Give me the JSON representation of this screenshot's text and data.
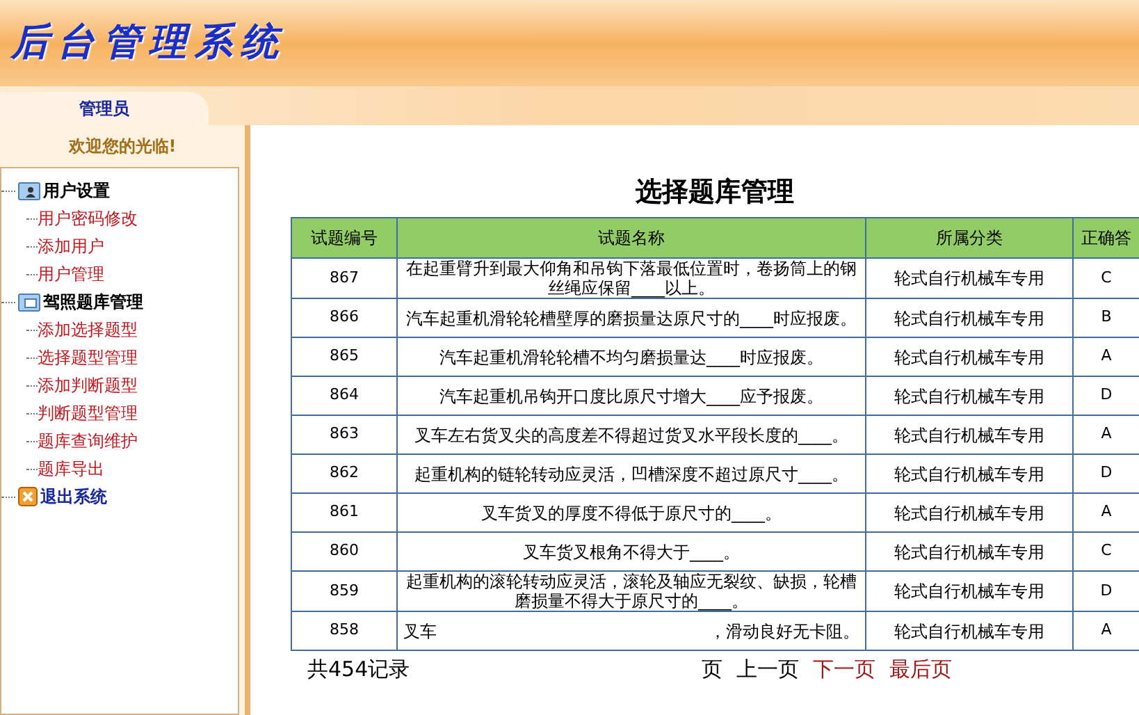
{
  "header": {
    "title": "后台管理系统"
  },
  "sidebar": {
    "tab": "管理员",
    "welcome": "欢迎您的光临!",
    "tree": [
      {
        "label": "用户设置",
        "kind": "user",
        "children": [
          {
            "label": "用户密码修改"
          },
          {
            "label": "添加用户"
          },
          {
            "label": "用户管理"
          }
        ]
      },
      {
        "label": "驾照题库管理",
        "kind": "card",
        "children": [
          {
            "label": "添加选择题型"
          },
          {
            "label": "选择题型管理"
          },
          {
            "label": "添加判断题型"
          },
          {
            "label": "判断题型管理"
          },
          {
            "label": "题库查询维护"
          },
          {
            "label": "题库导出"
          }
        ]
      },
      {
        "label": "退出系统",
        "kind": "exit"
      }
    ]
  },
  "page": {
    "title": "选择题库管理"
  },
  "table": {
    "columns": [
      "试题编号",
      "试题名称",
      "所属分类",
      "正确答"
    ],
    "rows": [
      {
        "id": "867",
        "name": "在起重臂升到最大仰角和吊钩下落最低位置时，卷扬筒上的钢丝绳应保留____以上。",
        "category": "轮式自行机械车专用",
        "answer": "C"
      },
      {
        "id": "866",
        "name": "汽车起重机滑轮轮槽壁厚的磨损量达原尺寸的____时应报废。",
        "category": "轮式自行机械车专用",
        "answer": "B"
      },
      {
        "id": "865",
        "name": "汽车起重机滑轮轮槽不均匀磨损量达____时应报废。",
        "category": "轮式自行机械车专用",
        "answer": "A"
      },
      {
        "id": "864",
        "name": "汽车起重机吊钩开口度比原尺寸增大____应予报废。",
        "category": "轮式自行机械车专用",
        "answer": "D"
      },
      {
        "id": "863",
        "name": "叉车左右货叉尖的高度差不得超过货叉水平段长度的____。",
        "category": "轮式自行机械车专用",
        "answer": "A"
      },
      {
        "id": "862",
        "name": "起重机构的链轮转动应灵活，凹槽深度不超过原尺寸____。",
        "category": "轮式自行机械车专用",
        "answer": "D"
      },
      {
        "id": "861",
        "name": "叉车货叉的厚度不得低于原尺寸的____。",
        "category": "轮式自行机械车专用",
        "answer": "A"
      },
      {
        "id": "860",
        "name": "叉车货叉根角不得大于____。",
        "category": "轮式自行机械车专用",
        "answer": "C"
      },
      {
        "id": "859",
        "name": "起重机构的滚轮转动应灵活，滚轮及轴应无裂纹、缺损，轮槽磨损量不得大于原尺寸的____。",
        "category": "轮式自行机械车专用",
        "answer": "D"
      },
      {
        "id": "858",
        "name_start": "叉车",
        "name_end": "，滑动良好无卡阻。",
        "category": "轮式自行机械车专用",
        "answer": "A"
      }
    ]
  },
  "pagination": {
    "total": "共454记录",
    "items": [
      {
        "label": "页",
        "kind": "text"
      },
      {
        "label": "上一页",
        "kind": "plain"
      },
      {
        "label": "下一页",
        "kind": "link"
      },
      {
        "label": "最后页",
        "kind": "link"
      }
    ]
  }
}
